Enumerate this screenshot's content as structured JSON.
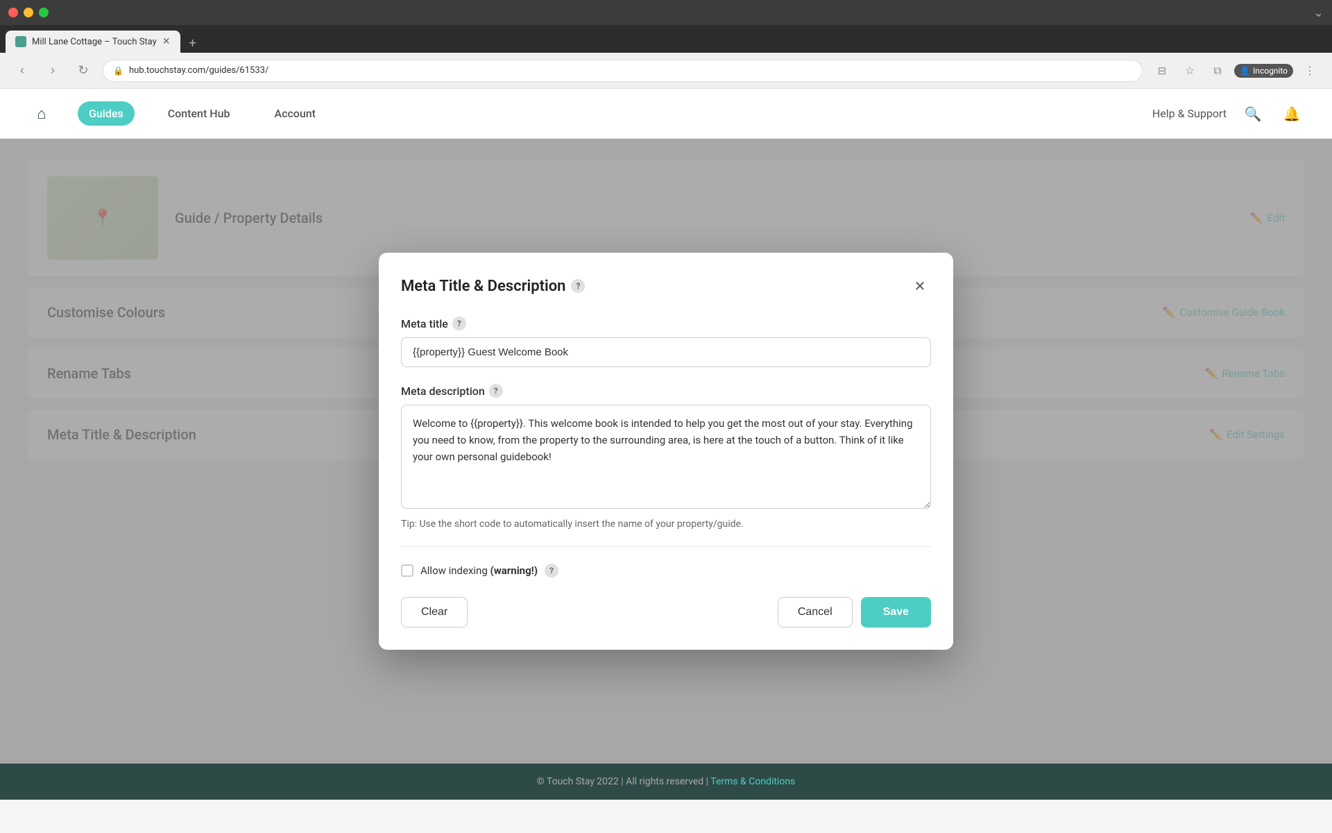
{
  "browser": {
    "tab_title": "Mill Lane Cottage – Touch Stay",
    "url": "hub.touchstay.com/guides/61533/",
    "new_tab_label": "+",
    "expand_label": "⌄",
    "incognito_label": "Incognito",
    "nav_back": "‹",
    "nav_forward": "›",
    "nav_reload": "↻"
  },
  "header": {
    "home_icon": "⌂",
    "nav_items": [
      {
        "label": "Guides",
        "active": true
      },
      {
        "label": "Content Hub",
        "active": false
      },
      {
        "label": "Account",
        "active": false
      }
    ],
    "help_label": "Help & Support",
    "search_icon": "🔍",
    "bell_icon": "🔔"
  },
  "page": {
    "sections": [
      {
        "title": "Guide / Property Details",
        "action": "Edit"
      },
      {
        "title": "Customise Colours",
        "action": "Customise Guide Book"
      },
      {
        "title": "Rename Tabs",
        "action": "Rename Tabs"
      },
      {
        "title": "Meta Title & Description",
        "action": "Edit Settings"
      }
    ]
  },
  "modal": {
    "title": "Meta Title & Description",
    "help_icon": "?",
    "close_icon": "×",
    "meta_title_label": "Meta title",
    "meta_title_help": "?",
    "meta_title_value": "{{property}} Guest Welcome Book",
    "meta_description_label": "Meta description",
    "meta_description_help": "?",
    "meta_description_value": "Welcome to {{property}}. This welcome book is intended to help you get the most out of your stay. Everything you need to know, from the property to the surrounding area, is here at the touch of a button. Think of it like your own personal guidebook!",
    "tip_text": "Tip: Use the short code to automatically insert the name of your property/guide.",
    "allow_indexing_label": "Allow indexing",
    "allow_indexing_warning": "(warning!)",
    "allow_indexing_help": "?",
    "btn_clear": "Clear",
    "btn_cancel": "Cancel",
    "btn_save": "Save"
  },
  "footer": {
    "copyright": "© Touch Stay 2022 | All rights reserved |",
    "terms_label": "Terms & Conditions"
  }
}
